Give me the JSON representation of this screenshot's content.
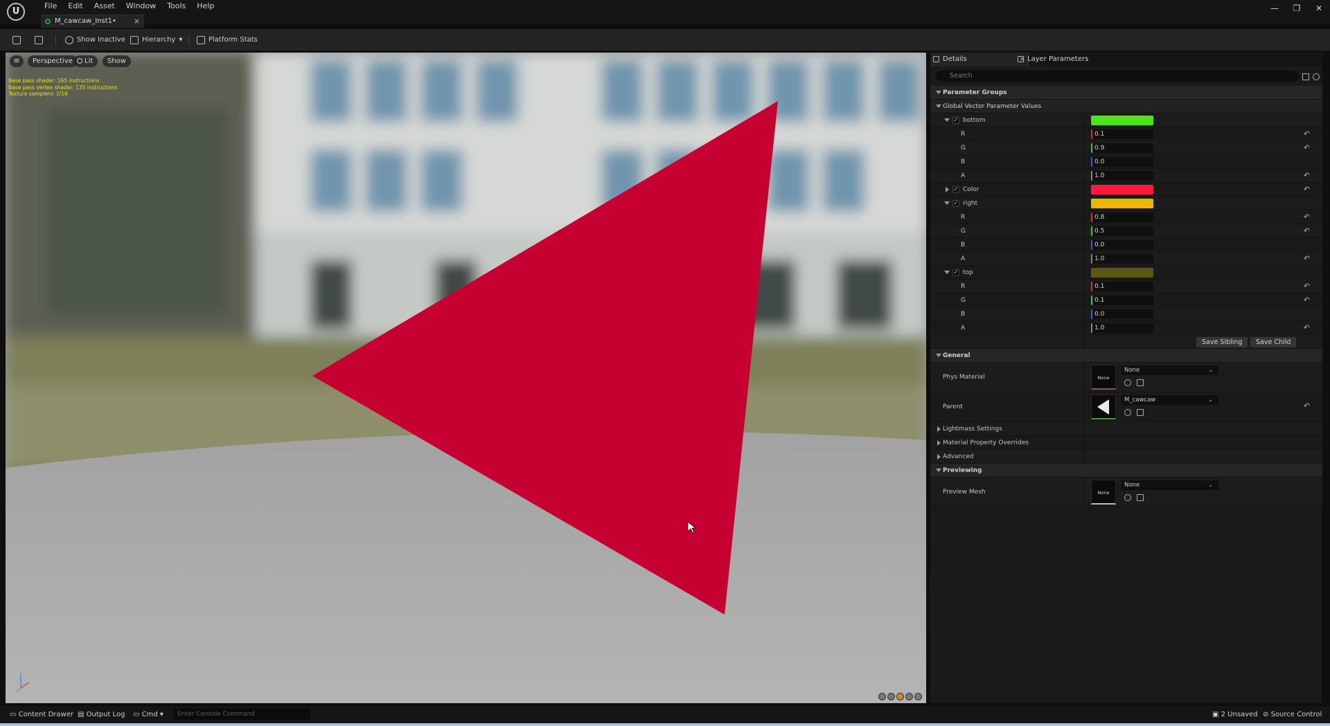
{
  "menu": [
    "File",
    "Edit",
    "Asset",
    "Window",
    "Tools",
    "Help"
  ],
  "document_tab": {
    "title": "M_cawcaw_Inst1•",
    "close": "×"
  },
  "window_controls": [
    "—",
    "❐",
    "✕"
  ],
  "toolbar": {
    "show_inactive": "Show Inactive",
    "hierarchy": "Hierarchy",
    "platform_stats": "Platform Stats"
  },
  "viewport": {
    "perspective": "Perspective",
    "lit": "Lit",
    "show": "Show",
    "stats": [
      "Base pass shader: 165 instructions",
      "Base pass vertex shader: 135 instructions",
      "Texture samplers: 2/16"
    ],
    "triangle_color": "#c70032"
  },
  "details": {
    "tab_details": "Details",
    "tab_layers": "Layer Parameters",
    "search_placeholder": "Search",
    "parameter_groups": "Parameter Groups",
    "global_vector": "Global Vector Parameter Values",
    "params": [
      {
        "name": "bottom",
        "color": "#4fe31a",
        "r": "0.1",
        "g": "0.9",
        "b": "0.0",
        "a": "1.0"
      },
      {
        "name": "Color",
        "color": "#ff1744"
      },
      {
        "name": "right",
        "color": "#e8b807",
        "r": "0.8",
        "g": "0.5",
        "b": "0.0",
        "a": "1.0"
      },
      {
        "name": "top",
        "color": "#5c5810",
        "r": "0.1",
        "g": "0.1",
        "b": "0.0",
        "a": "1.0"
      }
    ],
    "channel_labels": {
      "r": "R",
      "g": "G",
      "b": "B",
      "a": "A"
    },
    "save_sibling": "Save Sibling",
    "save_child": "Save Child",
    "general": "General",
    "phys_material": "Phys Material",
    "phys_material_value": "None",
    "parent": "Parent",
    "parent_value": "M_cawcaw",
    "lightmass": "Lightmass Settings",
    "overrides": "Material Property Overrides",
    "advanced": "Advanced",
    "previewing": "Previewing",
    "preview_mesh": "Preview Mesh",
    "preview_mesh_value": "None",
    "thumb_none": "None"
  },
  "statusbar": {
    "content_drawer": "Content Drawer",
    "output_log": "Output Log",
    "cmd": "Cmd",
    "console_placeholder": "Enter Console Command",
    "unsaved": "2 Unsaved",
    "source_control": "Source Control"
  }
}
